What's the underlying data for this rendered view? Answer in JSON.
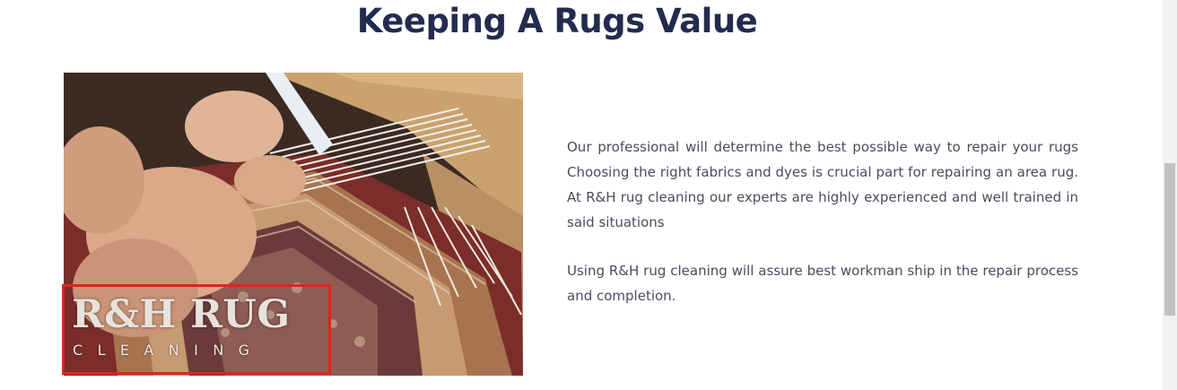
{
  "section": {
    "title": "Keeping A Rugs Value"
  },
  "logo": {
    "main": "R&H RUG",
    "sub": "CLEANING"
  },
  "content": {
    "paragraphs": [
      "Our professional will determine the best possible way to repair your rugs Choosing the right fabrics and dyes is crucial part for repairing an area rug. At R&H rug cleaning our experts are highly experienced and well trained in said situations",
      "Using R&H rug cleaning will assure best workman ship in the repair process and completion."
    ]
  },
  "colors": {
    "title": "#232c4f",
    "body_text": "#4a4d5c",
    "logo_border": "#e0231e"
  }
}
